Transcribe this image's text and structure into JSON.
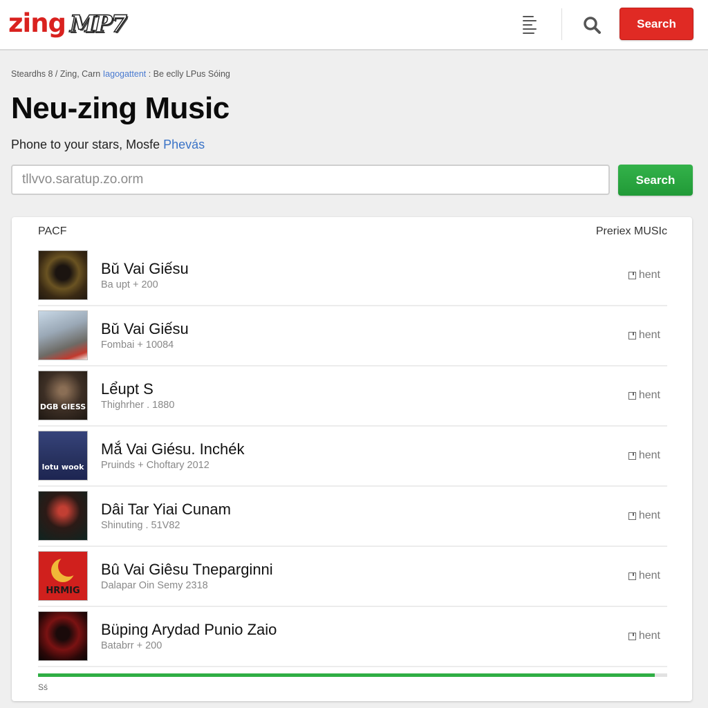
{
  "header": {
    "logo_brand": "zing",
    "logo_product": "MP7",
    "menu_icon": "menu-icon",
    "search_icon": "search-icon",
    "search_button_label": "Search"
  },
  "breadcrumb": {
    "prefix": "Steardhs 8 / Zing, Carn ",
    "link": "Iagogattent",
    "suffix": " : Be eclly LPus Sóing"
  },
  "page": {
    "title": "Neu-zing Music",
    "subtitle_text": "Phone to your stars, Mosfe ",
    "subtitle_link": "Phevás"
  },
  "search": {
    "placeholder": "tllvvo.saratup.zo.orm",
    "value": "",
    "button_label": "Search"
  },
  "list": {
    "header_left": "PACF",
    "header_right": "Preriex MUSIc",
    "items": [
      {
        "title": "Bǔ Vai Giếsu",
        "subtitle": "Ba upt + 200",
        "action": "hent",
        "cover_text": ""
      },
      {
        "title": "Bǔ Vai Giếsu",
        "subtitle": "Fombai + 10084",
        "action": "hent",
        "cover_text": ""
      },
      {
        "title": "Lểupt S",
        "subtitle": "Thighrher . 1880",
        "action": "hent",
        "cover_text": "DGB GIESS"
      },
      {
        "title": "Mắ Vai Giésu. Inchék",
        "subtitle": "Pruinds + Choftary 2012",
        "action": "hent",
        "cover_text": "lotu wook"
      },
      {
        "title": "Dâi Tar Yiai Cunam",
        "subtitle": "Shinuting . 51V82",
        "action": "hent",
        "cover_text": ""
      },
      {
        "title": "Bû Vai Giêsu Tneparginni",
        "subtitle": "Dalapar Oin Semy 2318",
        "action": "hent",
        "cover_text": "HRMIG"
      },
      {
        "title": "Büping Arydad Punio Zaio",
        "subtitle": "Batabrr + 200",
        "action": "hent",
        "cover_text": ""
      }
    ],
    "progress_percent": 98,
    "progress_label": "Sś"
  },
  "colors": {
    "brand_red": "#e02a24",
    "accent_green": "#2fae44",
    "link_blue": "#3a73c7"
  }
}
